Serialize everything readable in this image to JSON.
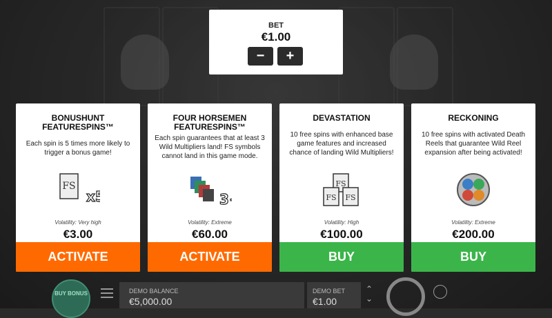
{
  "bet": {
    "label": "BET",
    "value": "€1.00",
    "minus_label": "−",
    "plus_label": "+"
  },
  "cards": [
    {
      "title": "BONUSHUNT FEATURESPINS™",
      "description": "Each spin is 5 times more likely to trigger a bonus game!",
      "icon": "fs-x5-icon",
      "icon_text": "x5",
      "volatility": "Volatility: Very high",
      "price": "€3.00",
      "button": "ACTIVATE"
    },
    {
      "title": "FOUR HORSEMEN FEATURESPINS™",
      "description": "Each spin guarantees that at least 3 Wild Multipliers land! FS symbols cannot land in this game mode.",
      "icon": "wild-multipliers-3plus-icon",
      "icon_text": "3+",
      "volatility": "Volatility: Extreme",
      "price": "€60.00",
      "button": "ACTIVATE"
    },
    {
      "title": "DEVASTATION",
      "description": "10 free spins with enhanced base game features and increased chance of landing Wild Multipliers!",
      "icon": "fs-triple-icon",
      "volatility": "Volatility: High",
      "price": "€100.00",
      "button": "BUY"
    },
    {
      "title": "RECKONING",
      "description": "10 free spins with activated Death Reels that guarantee Wild Reel expansion after being activated!",
      "icon": "death-reels-medallion-icon",
      "volatility": "Volatility: Extreme",
      "price": "€200.00",
      "button": "BUY"
    }
  ],
  "bottom": {
    "buy_bonus_label": "BUY BONUS",
    "balance_label": "DEMO BALANCE",
    "balance_value": "€5,000.00",
    "demo_bet_label": "DEMO BET",
    "demo_bet_value": "€1.00"
  },
  "colors": {
    "activate": "#ff6a00",
    "buy": "#3bb54a"
  }
}
